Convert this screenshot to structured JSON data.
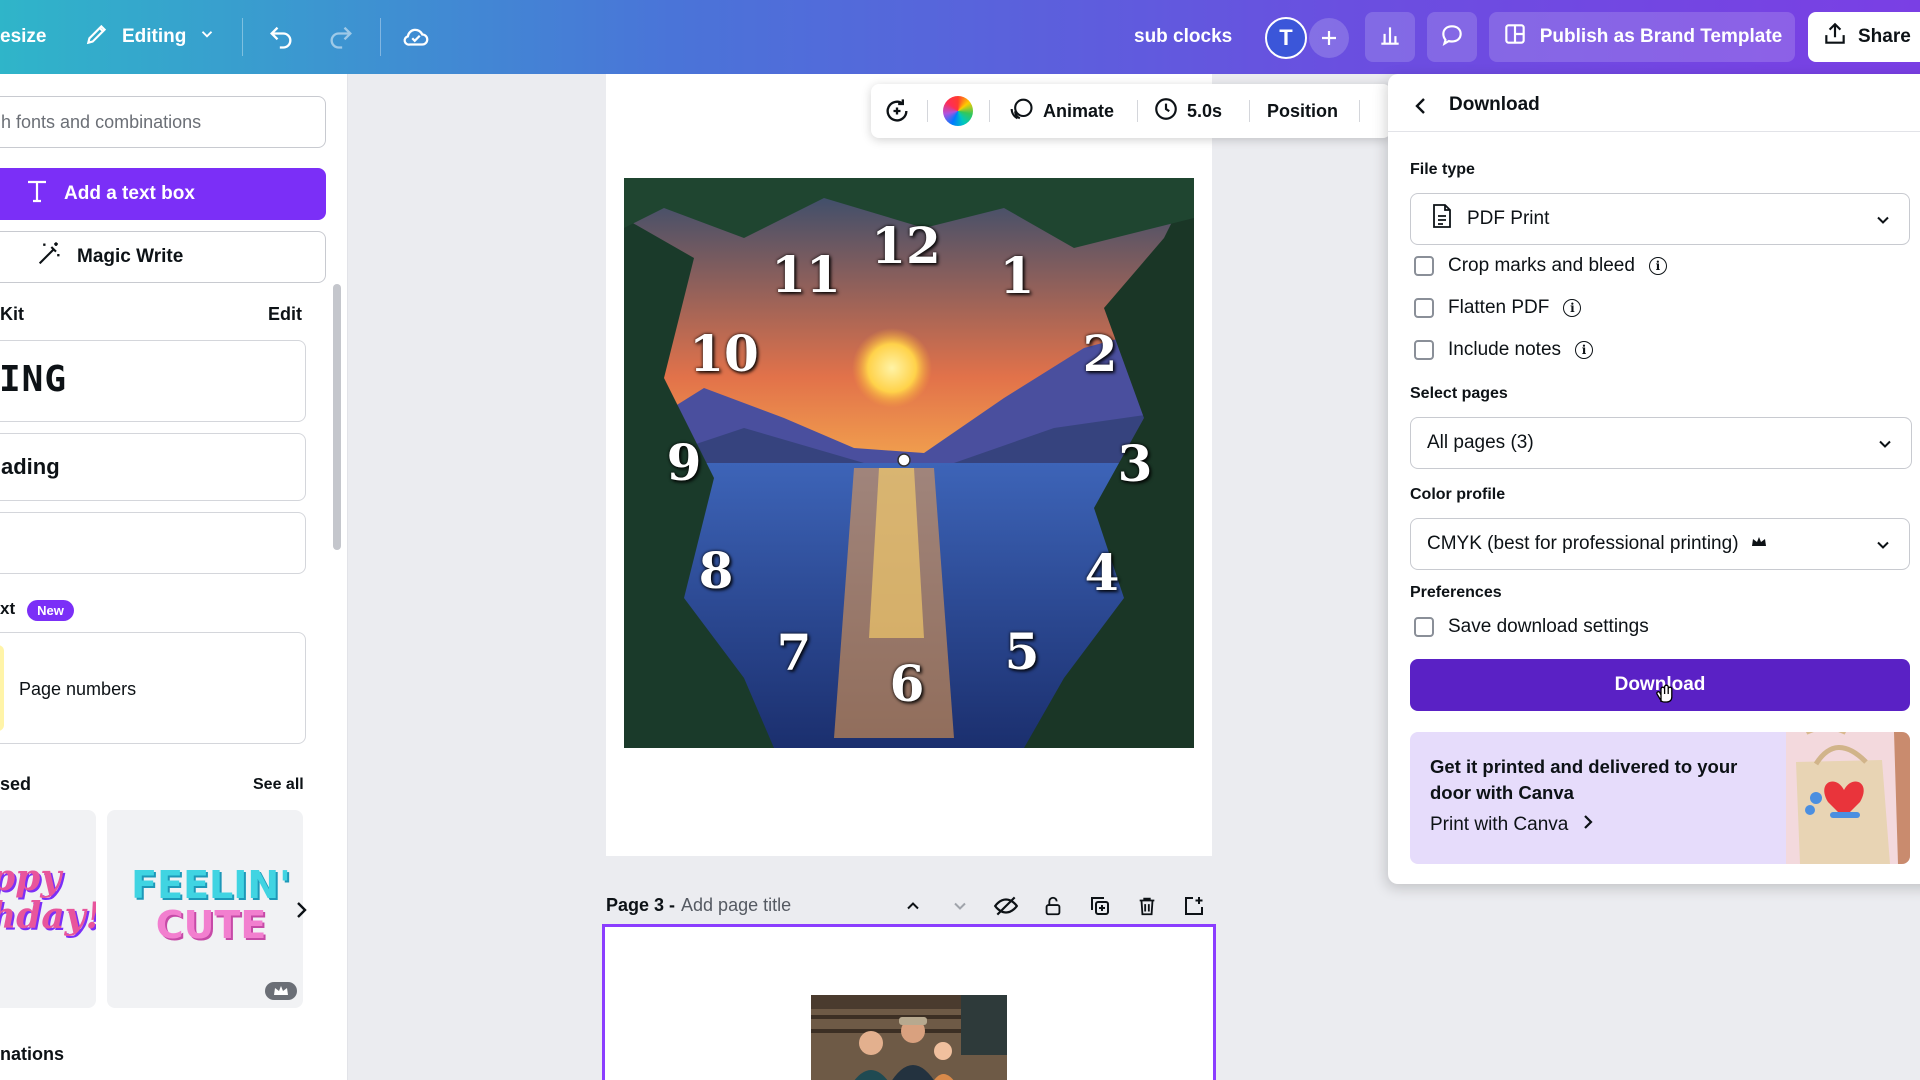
{
  "topbar": {
    "resize_label": "esize",
    "editing_label": "Editing",
    "doc_title": "sub clocks",
    "avatar_initial": "T",
    "publish_label": "Publish as Brand Template",
    "share_label": "Share"
  },
  "left_panel": {
    "search_placeholder": "h fonts and combinations",
    "add_text_box": "Add a text box",
    "magic_write": "Magic Write",
    "brand_kit_label": "Kit",
    "brand_kit_edit": "Edit",
    "heading_sample": "ING",
    "subheading_sample": "ading",
    "dynamic_text_label": "xt",
    "new_badge": "New",
    "page_numbers": "Page numbers",
    "recently_used_label": "sed",
    "see_all": "See all",
    "thumb_1_text": [
      "ppy",
      "hday!"
    ],
    "thumb_2_text": [
      "FEELIN'",
      "CUTE"
    ],
    "combinations_label": "nations"
  },
  "canvas": {
    "clock_numbers": [
      "12",
      "1",
      "2",
      "3",
      "4",
      "5",
      "6",
      "7",
      "8",
      "9",
      "10",
      "11"
    ],
    "page3_title_prefix": "Page 3 -",
    "page3_title_placeholder": "Add page title"
  },
  "floating_toolbar": {
    "animate": "Animate",
    "duration": "5.0s",
    "position": "Position"
  },
  "download_panel": {
    "title": "Download",
    "file_type_label": "File type",
    "file_type_value": "PDF Print",
    "crop_marks": "Crop marks and bleed",
    "flatten_pdf": "Flatten PDF",
    "include_notes": "Include notes",
    "select_pages_label": "Select pages",
    "select_pages_value": "All pages (3)",
    "color_profile_label": "Color profile",
    "color_profile_value": "CMYK (best for professional printing)",
    "preferences_label": "Preferences",
    "save_settings": "Save download settings",
    "download_button": "Download",
    "promo_title": "Get it printed and delivered to your door with Canva",
    "promo_link": "Print with Canva"
  },
  "colors": {
    "accent_purple": "#7b2ff7",
    "download_button": "#5a21c5",
    "page_selected_border": "#8b3dff"
  }
}
